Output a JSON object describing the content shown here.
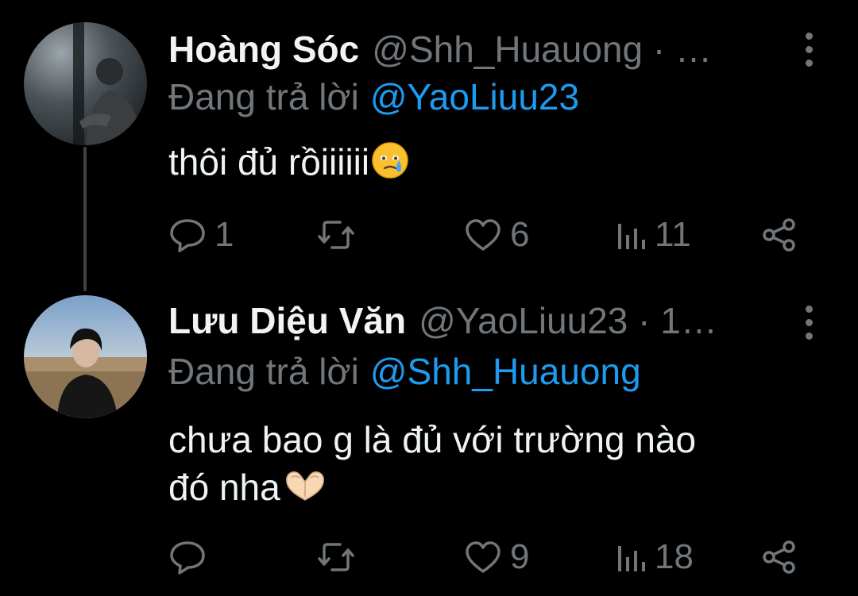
{
  "tweets": [
    {
      "name": "Hoàng Sóc",
      "handle": "@Shh_Huauong · …",
      "replying_prefix": "Đang trả lời",
      "replying_to": "@YaoLiuu23",
      "text": "thôi đủ rồiiiiii",
      "emoji": "face-holding-back-tears",
      "replies": "1",
      "retweets": "",
      "likes": "6",
      "views": "11"
    },
    {
      "name": "Lưu Diệu Văn",
      "handle": "@YaoLiuu23 · 1…",
      "replying_prefix": "Đang trả lời",
      "replying_to": "@Shh_Huauong",
      "text_line1": "chưa bao g là đủ với trường nào",
      "text_line2": "đó nha",
      "emoji": "heart-hands",
      "replies": "",
      "retweets": "",
      "likes": "9",
      "views": "18"
    }
  ],
  "colors": {
    "background": "#000000",
    "text": "#eff3f4",
    "secondary": "#71767b",
    "link": "#1d9bf0",
    "thread_line": "#3e4144"
  }
}
